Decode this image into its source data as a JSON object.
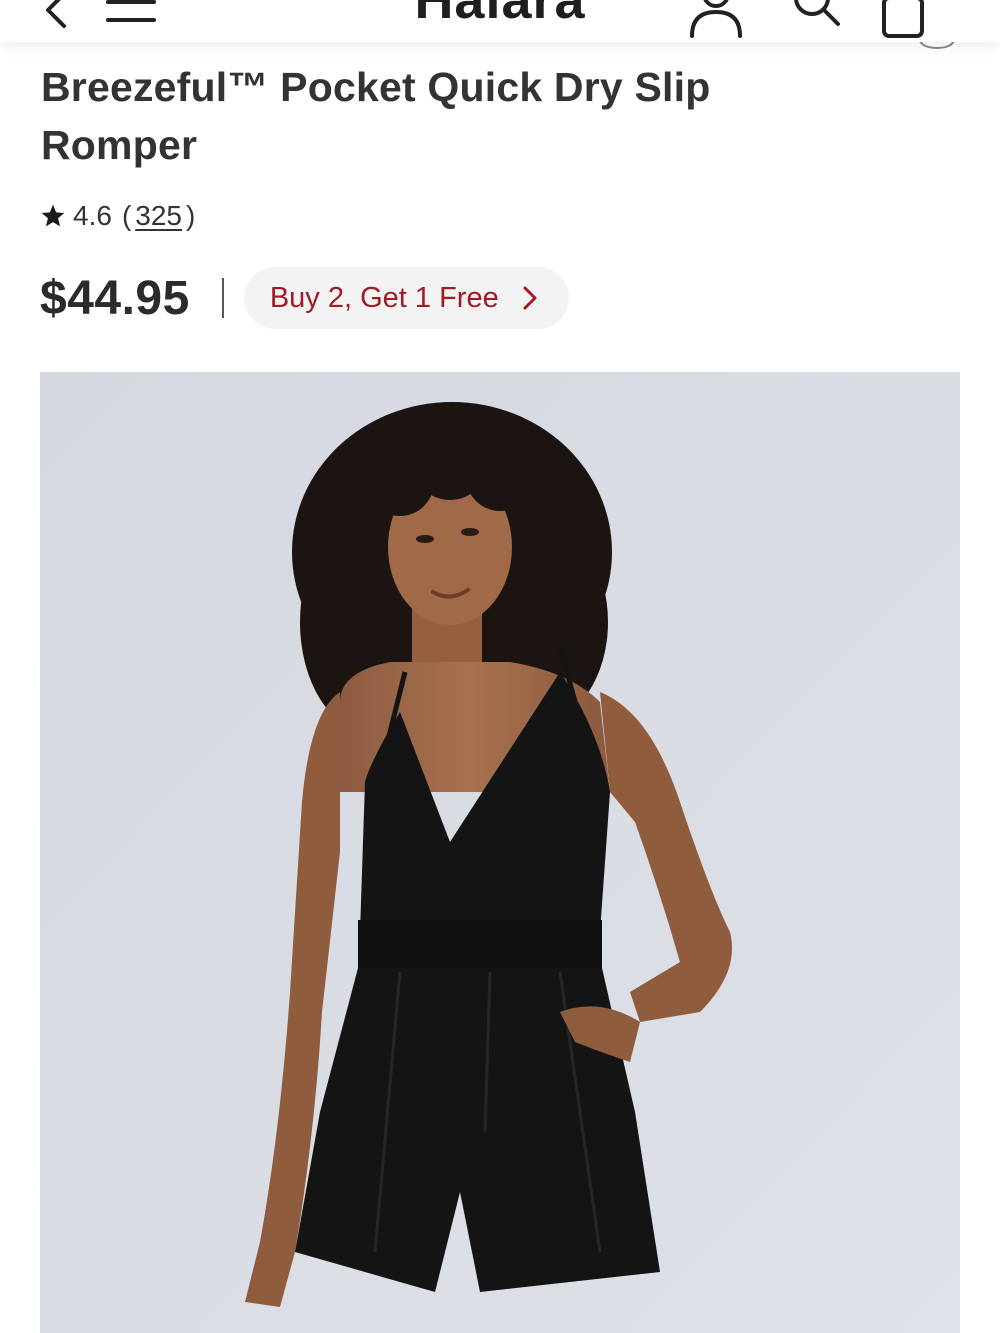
{
  "header": {
    "logo_text": "Halara",
    "icons": [
      "back-icon",
      "menu-icon",
      "account-icon",
      "search-icon",
      "bag-icon",
      "share-icon"
    ]
  },
  "product": {
    "title": "Breezeful™ Pocket Quick Dry Slip Romper",
    "rating": "4.6",
    "review_count": "325",
    "paren_open": "(",
    "paren_close": ")",
    "price": "$44.95",
    "promo_label": "Buy 2, Get 1 Free"
  },
  "colors": {
    "promo_text": "#a11a24",
    "promo_bg": "#f3f3f3",
    "image_bg": "#dcdee6",
    "garment": "#141414"
  }
}
